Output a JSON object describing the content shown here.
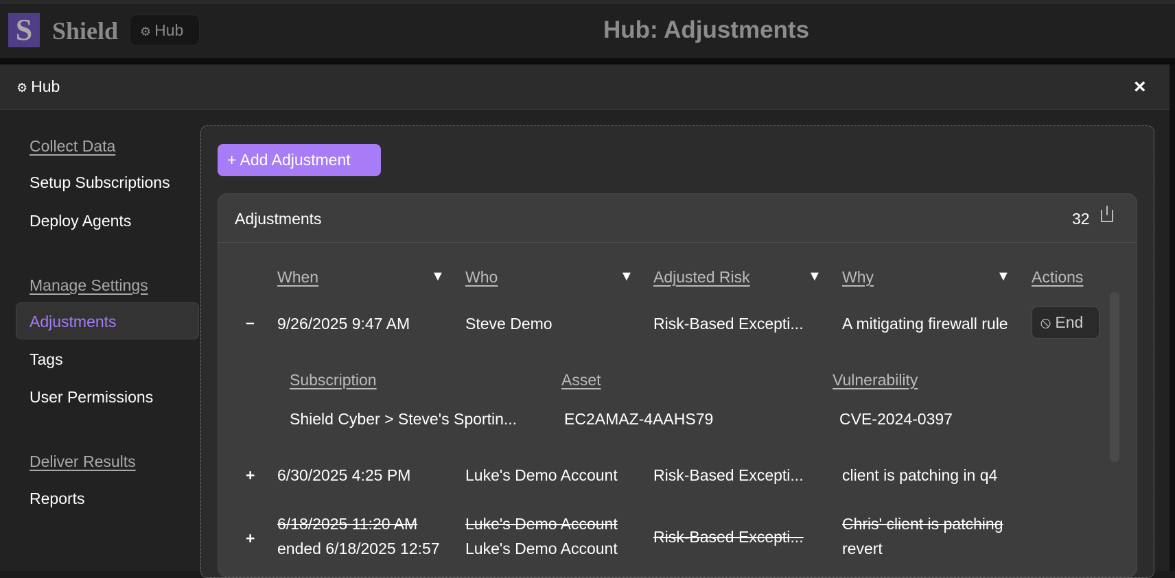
{
  "app": {
    "logo_letter": "S",
    "brand": "Shield",
    "hub_chip": "Hub",
    "title": "Hub: Adjustments"
  },
  "panel": {
    "title": "Hub",
    "close": "×"
  },
  "sidebar": {
    "sections": [
      {
        "label": "Collect Data",
        "items": [
          "Setup Subscriptions",
          "Deploy Agents"
        ]
      },
      {
        "label": "Manage Settings",
        "items": [
          "Adjustments",
          "Tags",
          "User Permissions"
        ]
      },
      {
        "label": "Deliver Results",
        "items": [
          "Reports"
        ]
      }
    ],
    "selected": "Adjustments"
  },
  "toolbar": {
    "add_label": "+ Add Adjustment"
  },
  "card": {
    "title": "Adjustments",
    "count": "32"
  },
  "table": {
    "headers": [
      "When",
      "Who",
      "Adjusted Risk",
      "Why",
      "Actions"
    ],
    "rows": [
      {
        "toggle": "–",
        "when": "9/26/2025 9:47 AM",
        "who": "Steve Demo",
        "risk": "Risk-Based Excepti...",
        "why": "A mitigating firewall rule",
        "action": "End",
        "detail": {
          "headers": [
            "Subscription",
            "Asset",
            "Vulnerability"
          ],
          "values": [
            "Shield Cyber > Steve's Sportin...",
            "EC2AMAZ-4AAHS79",
            "CVE-2024-0397"
          ]
        }
      },
      {
        "toggle": "+",
        "when": "6/30/2025 4:25 PM",
        "who": "Luke's Demo Account",
        "risk": "Risk-Based Excepti...",
        "why": "client is patching in q4"
      },
      {
        "toggle": "+",
        "when": "6/18/2025 11:20 AM",
        "ended": "ended 6/18/2025 12:57",
        "who": "Luke's Demo Account",
        "ended_by": "Luke's Demo Account",
        "risk": "Risk-Based Excepti...",
        "why": "Chris' client is patching",
        "end_reason": "revert"
      }
    ]
  }
}
